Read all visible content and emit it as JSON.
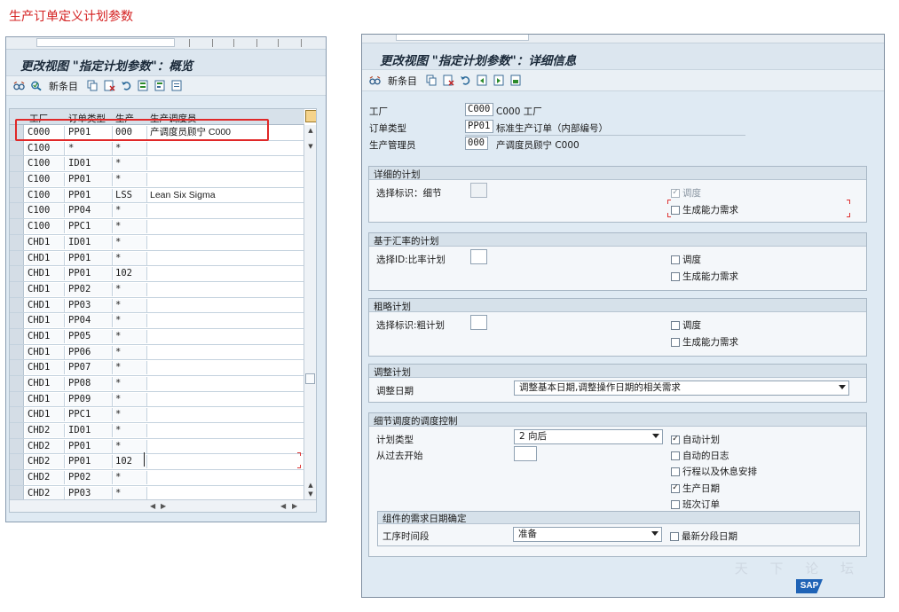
{
  "page_heading": "生产订单定义计划参数",
  "overview": {
    "title": "更改视图 \"指定计划参数\"：概览",
    "toolbar": {
      "new_entries_label": "新条目"
    },
    "columns": [
      "工厂",
      "订单类型",
      "生产",
      "生产调度员"
    ],
    "rows": [
      {
        "plant": "C000",
        "order_type": "PP01",
        "prod": "000",
        "scheduler": "产调度员顾宁 C000"
      },
      {
        "plant": "C100",
        "order_type": "*",
        "prod": "*",
        "scheduler": ""
      },
      {
        "plant": "C100",
        "order_type": "ID01",
        "prod": "*",
        "scheduler": ""
      },
      {
        "plant": "C100",
        "order_type": "PP01",
        "prod": "*",
        "scheduler": ""
      },
      {
        "plant": "C100",
        "order_type": "PP01",
        "prod": "LSS",
        "scheduler": "Lean Six Sigma"
      },
      {
        "plant": "C100",
        "order_type": "PP04",
        "prod": "*",
        "scheduler": ""
      },
      {
        "plant": "C100",
        "order_type": "PPC1",
        "prod": "*",
        "scheduler": ""
      },
      {
        "plant": "CHD1",
        "order_type": "ID01",
        "prod": "*",
        "scheduler": ""
      },
      {
        "plant": "CHD1",
        "order_type": "PP01",
        "prod": "*",
        "scheduler": ""
      },
      {
        "plant": "CHD1",
        "order_type": "PP01",
        "prod": "102",
        "scheduler": ""
      },
      {
        "plant": "CHD1",
        "order_type": "PP02",
        "prod": "*",
        "scheduler": ""
      },
      {
        "plant": "CHD1",
        "order_type": "PP03",
        "prod": "*",
        "scheduler": ""
      },
      {
        "plant": "CHD1",
        "order_type": "PP04",
        "prod": "*",
        "scheduler": ""
      },
      {
        "plant": "CHD1",
        "order_type": "PP05",
        "prod": "*",
        "scheduler": ""
      },
      {
        "plant": "CHD1",
        "order_type": "PP06",
        "prod": "*",
        "scheduler": ""
      },
      {
        "plant": "CHD1",
        "order_type": "PP07",
        "prod": "*",
        "scheduler": ""
      },
      {
        "plant": "CHD1",
        "order_type": "PP08",
        "prod": "*",
        "scheduler": ""
      },
      {
        "plant": "CHD1",
        "order_type": "PP09",
        "prod": "*",
        "scheduler": ""
      },
      {
        "plant": "CHD1",
        "order_type": "PPC1",
        "prod": "*",
        "scheduler": ""
      },
      {
        "plant": "CHD2",
        "order_type": "ID01",
        "prod": "*",
        "scheduler": ""
      },
      {
        "plant": "CHD2",
        "order_type": "PP01",
        "prod": "*",
        "scheduler": ""
      },
      {
        "plant": "CHD2",
        "order_type": "PP01",
        "prod": "102",
        "scheduler": ""
      },
      {
        "plant": "CHD2",
        "order_type": "PP02",
        "prod": "*",
        "scheduler": ""
      },
      {
        "plant": "CHD2",
        "order_type": "PP03",
        "prod": "*",
        "scheduler": ""
      }
    ]
  },
  "detail": {
    "title": "更改视图 \"指定计划参数\"：详细信息",
    "toolbar": {
      "new_entries_label": "新条目"
    },
    "header": {
      "plant_label": "工厂",
      "plant_value": "C000",
      "plant_text": "C000 工厂",
      "order_type_label": "订单类型",
      "order_type_value": "PP01",
      "order_type_text": "标准生产订单（内部编号）",
      "scheduler_label": "生产管理员",
      "scheduler_value": "000",
      "scheduler_text": "产调度员顾宁 C000"
    },
    "detailed_planning": {
      "title": "详细的计划",
      "selection_label": "选择标识：细节",
      "scheduling_label": "调度",
      "capacity_label": "生成能力需求"
    },
    "rate_planning": {
      "title": "基于汇率的计划",
      "selection_label": "选择ID:比率计划",
      "scheduling_label": "调度",
      "capacity_label": "生成能力需求"
    },
    "rough_planning": {
      "title": "粗略计划",
      "selection_label": "选择标识:粗计划",
      "scheduling_label": "调度",
      "capacity_label": "生成能力需求"
    },
    "adjust": {
      "title": "调整计划",
      "date_label": "调整日期",
      "date_value": "调整基本日期,调整操作日期的相关需求"
    },
    "scheduling_control": {
      "title": "细节调度的调度控制",
      "type_label": "计划类型",
      "type_value": "2 向后",
      "past_label": "从过去开始",
      "auto_schedule_label": "自动计划",
      "auto_log_label": "自动的日志",
      "breaks_label": "行程以及休息安排",
      "prod_dates_label": "生产日期",
      "shift_order_label": "班次订单"
    },
    "component_dates": {
      "title": "组件的需求日期确定",
      "segment_label": "工序时间段",
      "segment_value": "准备",
      "latest_label": "最新分段日期"
    }
  },
  "watermark": "天 下 论 坛",
  "logo_text": "SAP",
  "colors": {
    "heading_red": "#d42020",
    "highlight_frame": "#e02828"
  }
}
